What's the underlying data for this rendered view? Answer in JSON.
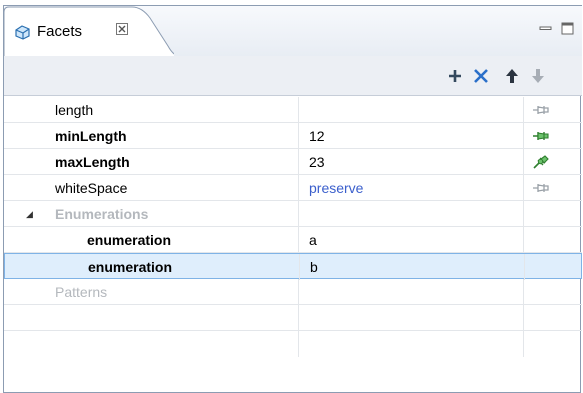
{
  "tab": {
    "title": "Facets",
    "close_glyph": "☒"
  },
  "toolbar": {
    "add_label": "+",
    "delete_label": "✕",
    "up_label": "↑",
    "down_label": "↓"
  },
  "rows": [
    {
      "name": "length",
      "value": "",
      "pin": "pin-gray-icon"
    },
    {
      "name": "minLength",
      "value": "12",
      "pin": "pin-green-icon"
    },
    {
      "name": "maxLength",
      "value": "23",
      "pin": "pin-green-angled-icon"
    },
    {
      "name": "whiteSpace",
      "value": "preserve",
      "pin": "pin-gray-icon"
    },
    {
      "name": "Enumerations",
      "value": "",
      "pin": ""
    },
    {
      "name": "enumeration",
      "value": "a",
      "pin": ""
    },
    {
      "name": "enumeration",
      "value": "b",
      "pin": ""
    },
    {
      "name": "Patterns",
      "value": "",
      "pin": ""
    }
  ],
  "colors": {
    "accent_blue": "#3b5fcc",
    "selection": "#dfeefc",
    "pin_green": "#3a9a3a",
    "disabled_text": "#b4b8bd"
  }
}
